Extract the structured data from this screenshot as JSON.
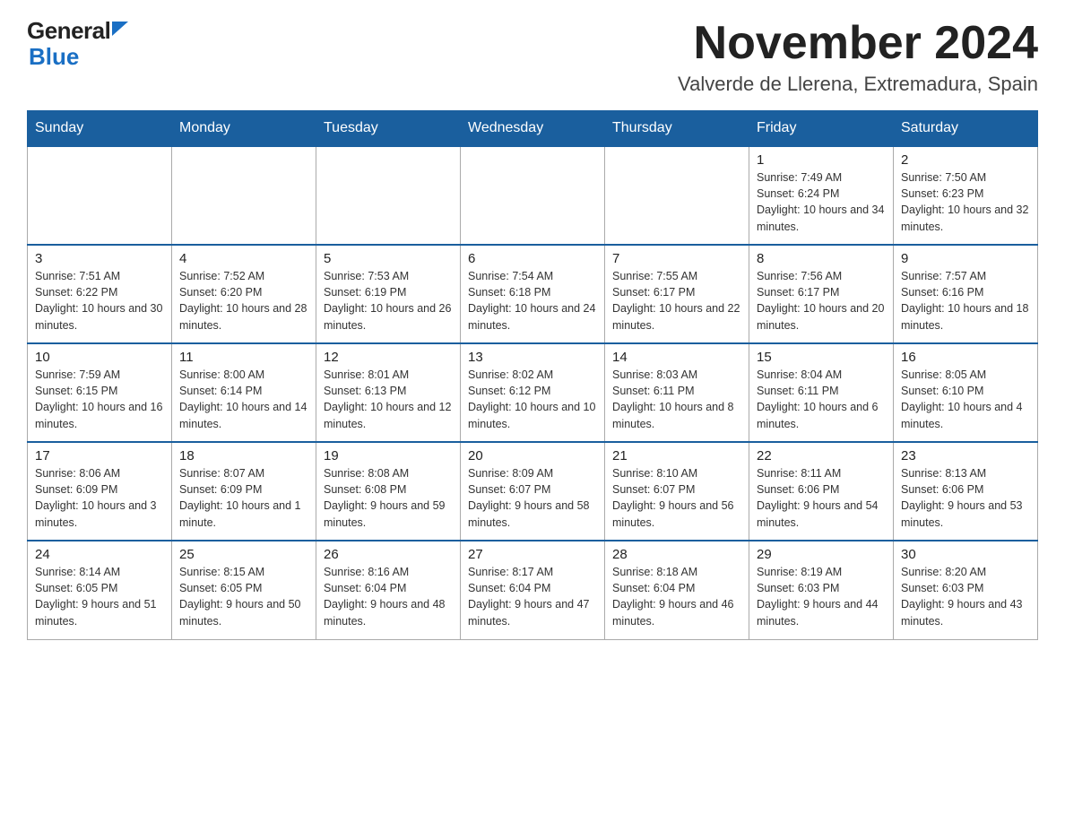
{
  "header": {
    "logo_general": "General",
    "logo_blue": "Blue",
    "month_title": "November 2024",
    "location": "Valverde de Llerena, Extremadura, Spain"
  },
  "days_of_week": [
    "Sunday",
    "Monday",
    "Tuesday",
    "Wednesday",
    "Thursday",
    "Friday",
    "Saturday"
  ],
  "weeks": [
    [
      {
        "day": "",
        "info": ""
      },
      {
        "day": "",
        "info": ""
      },
      {
        "day": "",
        "info": ""
      },
      {
        "day": "",
        "info": ""
      },
      {
        "day": "",
        "info": ""
      },
      {
        "day": "1",
        "info": "Sunrise: 7:49 AM\nSunset: 6:24 PM\nDaylight: 10 hours and 34 minutes."
      },
      {
        "day": "2",
        "info": "Sunrise: 7:50 AM\nSunset: 6:23 PM\nDaylight: 10 hours and 32 minutes."
      }
    ],
    [
      {
        "day": "3",
        "info": "Sunrise: 7:51 AM\nSunset: 6:22 PM\nDaylight: 10 hours and 30 minutes."
      },
      {
        "day": "4",
        "info": "Sunrise: 7:52 AM\nSunset: 6:20 PM\nDaylight: 10 hours and 28 minutes."
      },
      {
        "day": "5",
        "info": "Sunrise: 7:53 AM\nSunset: 6:19 PM\nDaylight: 10 hours and 26 minutes."
      },
      {
        "day": "6",
        "info": "Sunrise: 7:54 AM\nSunset: 6:18 PM\nDaylight: 10 hours and 24 minutes."
      },
      {
        "day": "7",
        "info": "Sunrise: 7:55 AM\nSunset: 6:17 PM\nDaylight: 10 hours and 22 minutes."
      },
      {
        "day": "8",
        "info": "Sunrise: 7:56 AM\nSunset: 6:17 PM\nDaylight: 10 hours and 20 minutes."
      },
      {
        "day": "9",
        "info": "Sunrise: 7:57 AM\nSunset: 6:16 PM\nDaylight: 10 hours and 18 minutes."
      }
    ],
    [
      {
        "day": "10",
        "info": "Sunrise: 7:59 AM\nSunset: 6:15 PM\nDaylight: 10 hours and 16 minutes."
      },
      {
        "day": "11",
        "info": "Sunrise: 8:00 AM\nSunset: 6:14 PM\nDaylight: 10 hours and 14 minutes."
      },
      {
        "day": "12",
        "info": "Sunrise: 8:01 AM\nSunset: 6:13 PM\nDaylight: 10 hours and 12 minutes."
      },
      {
        "day": "13",
        "info": "Sunrise: 8:02 AM\nSunset: 6:12 PM\nDaylight: 10 hours and 10 minutes."
      },
      {
        "day": "14",
        "info": "Sunrise: 8:03 AM\nSunset: 6:11 PM\nDaylight: 10 hours and 8 minutes."
      },
      {
        "day": "15",
        "info": "Sunrise: 8:04 AM\nSunset: 6:11 PM\nDaylight: 10 hours and 6 minutes."
      },
      {
        "day": "16",
        "info": "Sunrise: 8:05 AM\nSunset: 6:10 PM\nDaylight: 10 hours and 4 minutes."
      }
    ],
    [
      {
        "day": "17",
        "info": "Sunrise: 8:06 AM\nSunset: 6:09 PM\nDaylight: 10 hours and 3 minutes."
      },
      {
        "day": "18",
        "info": "Sunrise: 8:07 AM\nSunset: 6:09 PM\nDaylight: 10 hours and 1 minute."
      },
      {
        "day": "19",
        "info": "Sunrise: 8:08 AM\nSunset: 6:08 PM\nDaylight: 9 hours and 59 minutes."
      },
      {
        "day": "20",
        "info": "Sunrise: 8:09 AM\nSunset: 6:07 PM\nDaylight: 9 hours and 58 minutes."
      },
      {
        "day": "21",
        "info": "Sunrise: 8:10 AM\nSunset: 6:07 PM\nDaylight: 9 hours and 56 minutes."
      },
      {
        "day": "22",
        "info": "Sunrise: 8:11 AM\nSunset: 6:06 PM\nDaylight: 9 hours and 54 minutes."
      },
      {
        "day": "23",
        "info": "Sunrise: 8:13 AM\nSunset: 6:06 PM\nDaylight: 9 hours and 53 minutes."
      }
    ],
    [
      {
        "day": "24",
        "info": "Sunrise: 8:14 AM\nSunset: 6:05 PM\nDaylight: 9 hours and 51 minutes."
      },
      {
        "day": "25",
        "info": "Sunrise: 8:15 AM\nSunset: 6:05 PM\nDaylight: 9 hours and 50 minutes."
      },
      {
        "day": "26",
        "info": "Sunrise: 8:16 AM\nSunset: 6:04 PM\nDaylight: 9 hours and 48 minutes."
      },
      {
        "day": "27",
        "info": "Sunrise: 8:17 AM\nSunset: 6:04 PM\nDaylight: 9 hours and 47 minutes."
      },
      {
        "day": "28",
        "info": "Sunrise: 8:18 AM\nSunset: 6:04 PM\nDaylight: 9 hours and 46 minutes."
      },
      {
        "day": "29",
        "info": "Sunrise: 8:19 AM\nSunset: 6:03 PM\nDaylight: 9 hours and 44 minutes."
      },
      {
        "day": "30",
        "info": "Sunrise: 8:20 AM\nSunset: 6:03 PM\nDaylight: 9 hours and 43 minutes."
      }
    ]
  ]
}
